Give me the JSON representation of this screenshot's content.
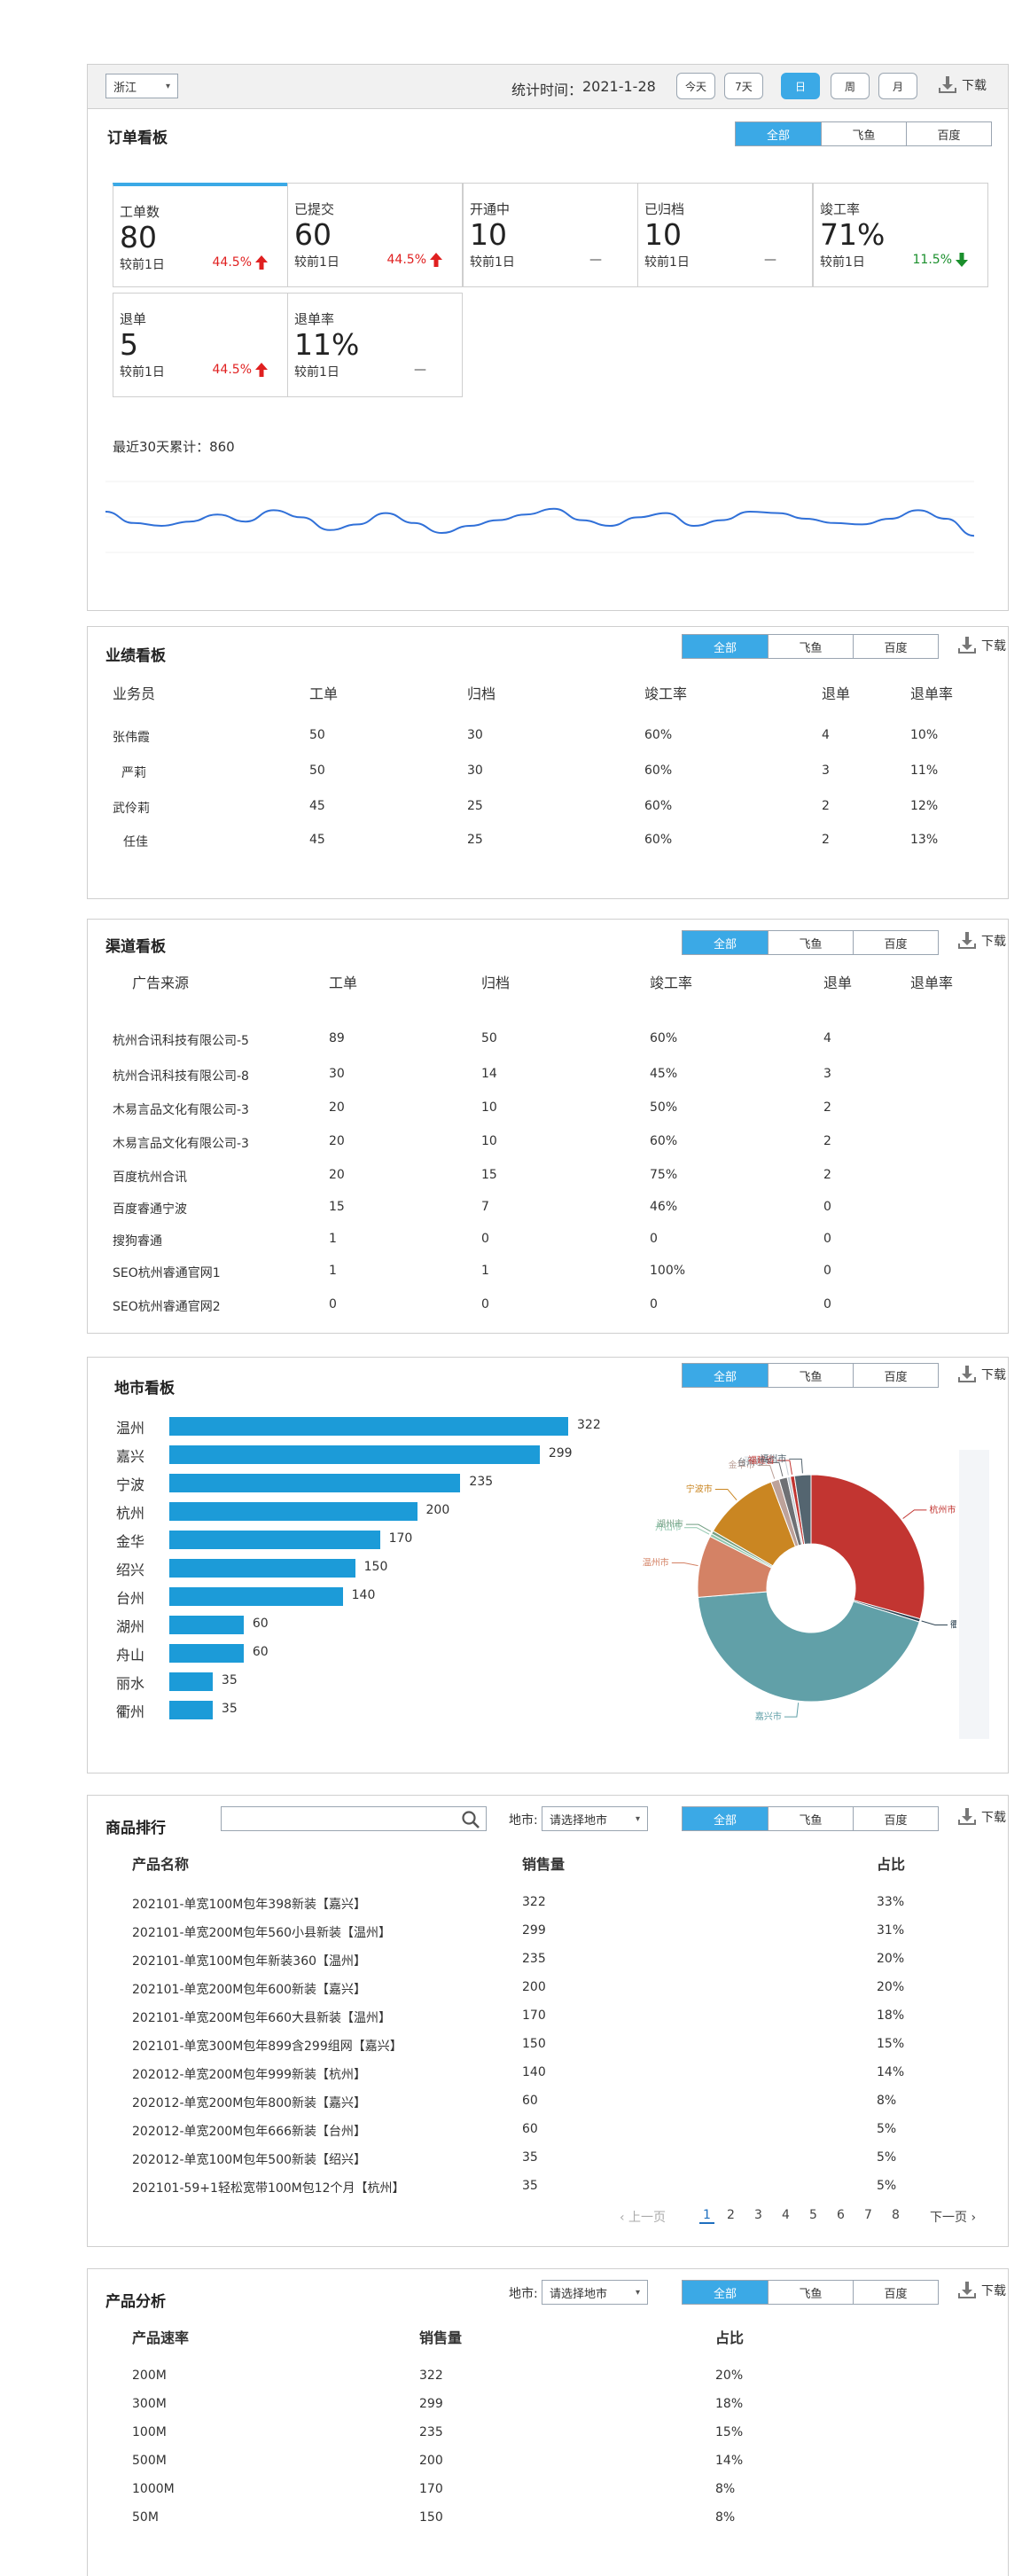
{
  "header": {
    "province_select": "浙江",
    "stat_label": "统计时间：",
    "stat_date": "2021-1-28",
    "ranges": [
      "今天",
      "7天",
      "日",
      "周",
      "月"
    ],
    "active_range": "日",
    "download": "下载"
  },
  "tabs": [
    "全部",
    "飞鱼",
    "百度"
  ],
  "order_board": {
    "title": "订单看板",
    "compare_label": "较前1日",
    "cards": [
      {
        "label": "工单数",
        "value": "80",
        "change": "44.5%",
        "dir": "up"
      },
      {
        "label": "已提交",
        "value": "60",
        "change": "44.5%",
        "dir": "up"
      },
      {
        "label": "开通中",
        "value": "10",
        "change": "—",
        "dir": "flat"
      },
      {
        "label": "已归档",
        "value": "10",
        "change": "—",
        "dir": "flat"
      },
      {
        "label": "竣工率",
        "value": "71%",
        "change": "11.5%",
        "dir": "down"
      },
      {
        "label": "退单",
        "value": "5",
        "change": "44.5%",
        "dir": "up"
      },
      {
        "label": "退单率",
        "value": "11%",
        "change": "—",
        "dir": "flat"
      }
    ],
    "total_label": "最近30天累计：",
    "total_value": "860",
    "trend": [
      10,
      2,
      0,
      3,
      8,
      3,
      11,
      6,
      -3,
      1,
      9,
      2,
      -5,
      0,
      4,
      8,
      12,
      4,
      0,
      6,
      9,
      0,
      4,
      10,
      9,
      5,
      2,
      1,
      5,
      11,
      5,
      -7
    ],
    "line_color": "#3070d8"
  },
  "performance_board": {
    "title": "业绩看板",
    "columns": [
      "业务员",
      "工单",
      "归档",
      "竣工率",
      "退单",
      "退单率"
    ],
    "rows": [
      [
        "张伟霞",
        "50",
        "30",
        "60%",
        "4",
        "10%"
      ],
      [
        "严莉",
        "50",
        "30",
        "60%",
        "3",
        "11%"
      ],
      [
        "武伶莉",
        "45",
        "25",
        "60%",
        "2",
        "12%"
      ],
      [
        "任佳",
        "45",
        "25",
        "60%",
        "2",
        "13%"
      ]
    ]
  },
  "channel_board": {
    "title": "渠道看板",
    "columns": [
      "广告来源",
      "工单",
      "归档",
      "竣工率",
      "退单",
      "退单率"
    ],
    "rows": [
      [
        "杭州合讯科技有限公司-5",
        "89",
        "50",
        "60%",
        "4",
        ""
      ],
      [
        "杭州合讯科技有限公司-8",
        "30",
        "14",
        "45%",
        "3",
        ""
      ],
      [
        "木易言品文化有限公司-3",
        "20",
        "10",
        "50%",
        "2",
        ""
      ],
      [
        "木易言品文化有限公司-3",
        "20",
        "10",
        "60%",
        "2",
        ""
      ],
      [
        "百度杭州合讯",
        "20",
        "15",
        "75%",
        "2",
        ""
      ],
      [
        "百度睿通宁波",
        "15",
        "7",
        "46%",
        "0",
        ""
      ],
      [
        "搜狗睿通",
        "1",
        "0",
        "0",
        "0",
        ""
      ],
      [
        "SEO杭州睿通官网1",
        "1",
        "1",
        "100%",
        "0",
        ""
      ],
      [
        "SEO杭州睿通官网2",
        "0",
        "0",
        "0",
        "0",
        ""
      ]
    ]
  },
  "city_board": {
    "title": "地市看板",
    "bar_color": "#1c9bd8"
  },
  "chart_data": [
    {
      "type": "bar",
      "orientation": "horizontal",
      "categories": [
        "温州",
        "嘉兴",
        "宁波",
        "杭州",
        "金华",
        "绍兴",
        "台州",
        "湖州",
        "舟山",
        "丽水",
        "衢州"
      ],
      "values": [
        322,
        299,
        235,
        200,
        170,
        150,
        140,
        60,
        60,
        35,
        35
      ]
    },
    {
      "type": "pie",
      "style": "donut",
      "slices": [
        {
          "label": "杭州市",
          "value": 200,
          "color": "#c23531"
        },
        {
          "label": "衢州市",
          "value": 3,
          "color": "#2f4554"
        },
        {
          "label": "嘉兴市",
          "value": 299,
          "color": "#61a0a8"
        },
        {
          "label": "温州市",
          "value": 60,
          "color": "#d48265"
        },
        {
          "label": "舟山市",
          "value": 3,
          "color": "#91c7ae"
        },
        {
          "label": "湖州市",
          "value": 3,
          "color": "#749f83"
        },
        {
          "label": "宁波市",
          "value": 74,
          "color": "#ca8622"
        },
        {
          "label": "金华市",
          "value": 8,
          "color": "#bda29a"
        },
        {
          "label": "台州市",
          "value": 8,
          "color": "#6e7074"
        },
        {
          "label": "丽水市",
          "value": 3,
          "color": "#c4ccd3"
        },
        {
          "label": "福建省",
          "value": 4,
          "color": "#c23531"
        },
        {
          "label": "福州市",
          "value": 16,
          "color": "#546570"
        }
      ]
    }
  ],
  "product_rank": {
    "title": "商品排行",
    "search_placeholder": "",
    "city_label": "地市:",
    "city_select": "请选择地市",
    "columns": [
      "产品名称",
      "销售量",
      "占比"
    ],
    "rows": [
      [
        "202101-单宽100M包年398新装【嘉兴】",
        "322",
        "33%"
      ],
      [
        "202101-单宽200M包年560小县新装【温州】",
        "299",
        "31%"
      ],
      [
        "202101-单宽100M包年新装360【温州】",
        "235",
        "20%"
      ],
      [
        "202101-单宽200M包年600新装【嘉兴】",
        "200",
        "20%"
      ],
      [
        "202101-单宽200M包年660大县新装【温州】",
        "170",
        "18%"
      ],
      [
        "202101-单宽300M包年899含299组网【嘉兴】",
        "150",
        "15%"
      ],
      [
        "202012-单宽200M包年999新装【杭州】",
        "140",
        "14%"
      ],
      [
        "202012-单宽200M包年800新装【嘉兴】",
        "60",
        "8%"
      ],
      [
        "202012-单宽200M包年666新装【台州】",
        "60",
        "5%"
      ],
      [
        "202012-单宽100M包年500新装【绍兴】",
        "35",
        "5%"
      ],
      [
        "202101-59+1轻松宽带100M包12个月【杭州】",
        "35",
        "5%"
      ]
    ],
    "pager": {
      "prev": "上一页",
      "next": "下一页",
      "pages": [
        "1",
        "2",
        "3",
        "4",
        "5",
        "6",
        "7",
        "8"
      ],
      "current": "1"
    }
  },
  "product_analysis": {
    "title": "产品分析",
    "city_label": "地市:",
    "city_select": "请选择地市",
    "columns": [
      "产品速率",
      "销售量",
      "占比"
    ],
    "rows": [
      [
        "200M",
        "322",
        "20%"
      ],
      [
        "300M",
        "299",
        "18%"
      ],
      [
        "100M",
        "235",
        "15%"
      ],
      [
        "500M",
        "200",
        "14%"
      ],
      [
        "1000M",
        "170",
        "8%"
      ],
      [
        "50M",
        "150",
        "8%"
      ]
    ]
  }
}
